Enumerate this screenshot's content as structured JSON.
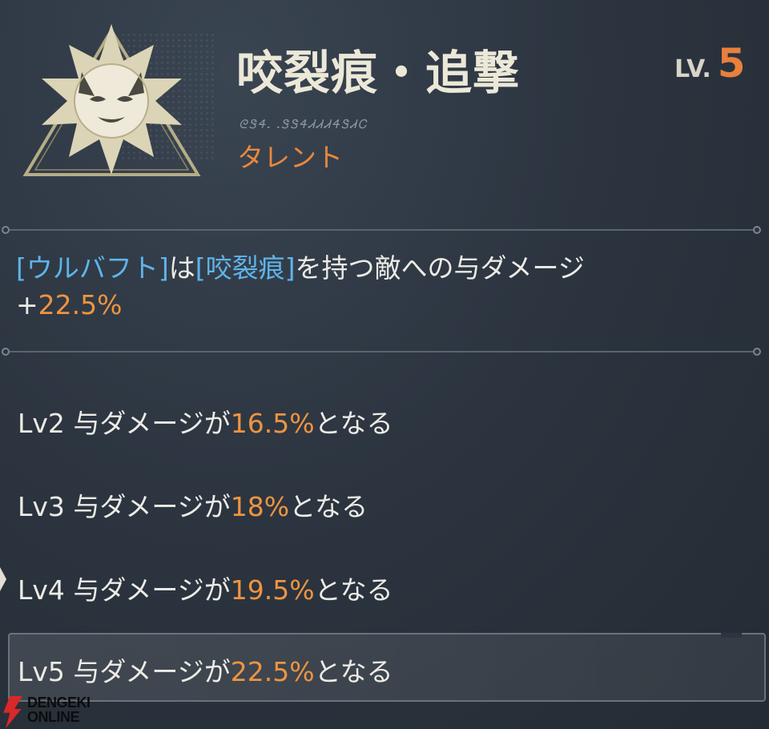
{
  "header": {
    "title": "咬裂痕・追撃",
    "level_prefix": "LV.",
    "level_value": "5",
    "script_text": "ᘓᏕᏎ᎐ ᎐ᏕᏕᏎᏗᏗᏗᏎᏕᏗᏟ",
    "category": "タレント",
    "emblem_icon": "wolf-emblem-icon"
  },
  "description": {
    "parts": [
      {
        "text": "[ウルバフト]",
        "style": "kw"
      },
      {
        "text": "は",
        "style": "plain"
      },
      {
        "text": "[咬裂痕]",
        "style": "kw"
      },
      {
        "text": "を持つ敵への与ダメージ",
        "style": "plain"
      },
      {
        "text": "+",
        "style": "plain"
      },
      {
        "text": "22.5%",
        "style": "pct"
      }
    ]
  },
  "levels": [
    {
      "prefix": "Lv2 与ダメージが",
      "value": "16.5%",
      "suffix": "となる"
    },
    {
      "prefix": "Lv3 与ダメージが",
      "value": "18%",
      "suffix": "となる"
    },
    {
      "prefix": "Lv4 与ダメージが",
      "value": "19.5%",
      "suffix": "となる"
    },
    {
      "prefix": "Lv5 与ダメージが",
      "value": "22.5%",
      "suffix": "となる"
    }
  ],
  "watermark": {
    "line1": "DENGEKI",
    "line2": "ONLINE"
  },
  "colors": {
    "accent_orange": "#e9803c",
    "keyword_blue": "#5fb4ea",
    "text": "#ecebe6"
  }
}
